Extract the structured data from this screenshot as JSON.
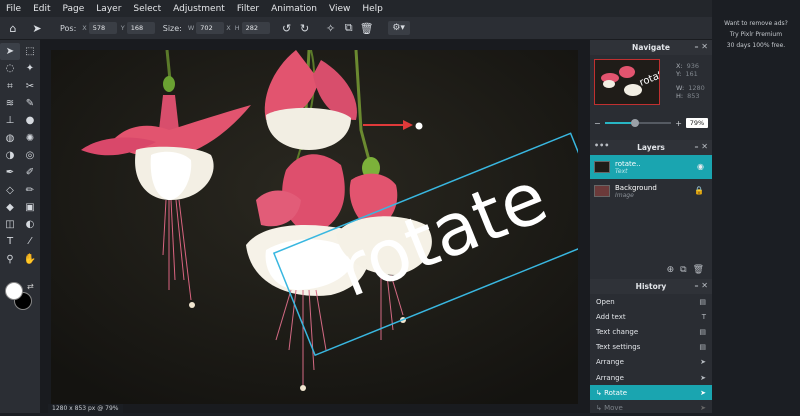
{
  "menu": [
    "File",
    "Edit",
    "Page",
    "Layer",
    "Select",
    "Adjustment",
    "Filter",
    "Animation",
    "View",
    "Help"
  ],
  "toolbar": {
    "pos_label": "Pos:",
    "x_label": "X",
    "x_value": "578",
    "y_label": "Y",
    "y_value": "168",
    "size_label": "Size:",
    "w_label": "W",
    "w_value": "702",
    "times": "X",
    "h_label": "H",
    "h_value": "282"
  },
  "canvas": {
    "text": "rotate",
    "status": "1280 x 853 px @ 79%"
  },
  "navigate": {
    "title": "Navigate",
    "x_label": "X:",
    "x": "936",
    "y_label": "Y:",
    "y": "161",
    "w_label": "W:",
    "w": "1280",
    "h_label": "H:",
    "h": "853",
    "zoom": "79%",
    "zoom_fraction": 0.45
  },
  "layers": {
    "title": "Layers",
    "items": [
      {
        "name": "rotate..",
        "type": "Text"
      },
      {
        "name": "Background",
        "type": "Image"
      }
    ]
  },
  "history": {
    "title": "History",
    "items": [
      "Open",
      "Add text",
      "Text change",
      "Text settings",
      "Arrange",
      "Arrange",
      "Rotate",
      "Move"
    ]
  },
  "ad": {
    "line1": "Want to remove ads?",
    "line2": "Try Pixlr Premium",
    "line3": "30 days 100% free."
  },
  "colors": {
    "accent": "#1aa5b0",
    "fg": "#ffffff",
    "bg": "#000000",
    "flower_pink": "#e0506a"
  }
}
